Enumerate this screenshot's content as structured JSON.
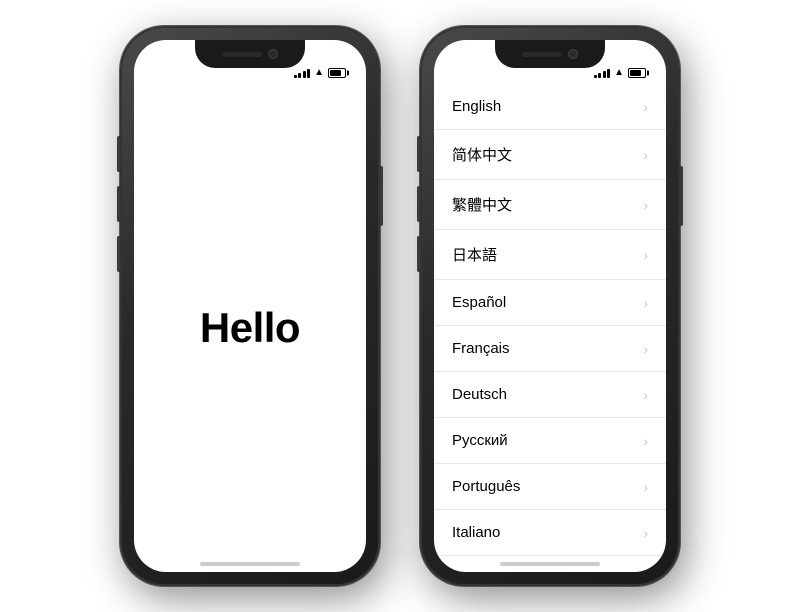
{
  "phone1": {
    "label": "hello-phone",
    "hello_text": "Hello"
  },
  "phone2": {
    "label": "language-phone",
    "languages": [
      {
        "name": "English"
      },
      {
        "name": "简体中文"
      },
      {
        "name": "繁體中文"
      },
      {
        "name": "日本語"
      },
      {
        "name": "Español"
      },
      {
        "name": "Français"
      },
      {
        "name": "Deutsch"
      },
      {
        "name": "Русский"
      },
      {
        "name": "Português"
      },
      {
        "name": "Italiano"
      }
    ]
  },
  "status": {
    "signal_bars": [
      3,
      5,
      7,
      9,
      11
    ],
    "battery_pct": 70
  }
}
